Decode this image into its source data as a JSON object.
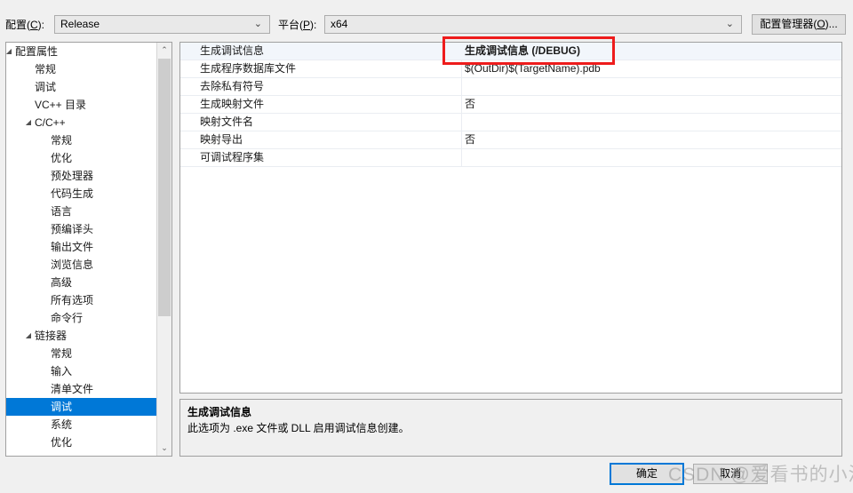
{
  "toolbar": {
    "config_label_prefix": "配置(",
    "config_label_key": "C",
    "config_label_suffix": "):",
    "config_value": "Release",
    "platform_label_prefix": "平台(",
    "platform_label_key": "P",
    "platform_label_suffix": "):",
    "platform_value": "x64",
    "config_manager_prefix": "配置管理器(",
    "config_manager_key": "O",
    "config_manager_suffix": ")...",
    "chevron": "⌄"
  },
  "tree": {
    "items": [
      {
        "label": "配置属性",
        "indent": 10,
        "arrow": "◢",
        "selected": false
      },
      {
        "label": "常规",
        "indent": 32,
        "arrow": "",
        "selected": false
      },
      {
        "label": "调试",
        "indent": 32,
        "arrow": "",
        "selected": false
      },
      {
        "label": "VC++ 目录",
        "indent": 32,
        "arrow": "",
        "selected": false
      },
      {
        "label": "C/C++",
        "indent": 32,
        "arrow": "◢",
        "selected": false
      },
      {
        "label": "常规",
        "indent": 50,
        "arrow": "",
        "selected": false
      },
      {
        "label": "优化",
        "indent": 50,
        "arrow": "",
        "selected": false
      },
      {
        "label": "预处理器",
        "indent": 50,
        "arrow": "",
        "selected": false
      },
      {
        "label": "代码生成",
        "indent": 50,
        "arrow": "",
        "selected": false
      },
      {
        "label": "语言",
        "indent": 50,
        "arrow": "",
        "selected": false
      },
      {
        "label": "预编译头",
        "indent": 50,
        "arrow": "",
        "selected": false
      },
      {
        "label": "输出文件",
        "indent": 50,
        "arrow": "",
        "selected": false
      },
      {
        "label": "浏览信息",
        "indent": 50,
        "arrow": "",
        "selected": false
      },
      {
        "label": "高级",
        "indent": 50,
        "arrow": "",
        "selected": false
      },
      {
        "label": "所有选项",
        "indent": 50,
        "arrow": "",
        "selected": false
      },
      {
        "label": "命令行",
        "indent": 50,
        "arrow": "",
        "selected": false
      },
      {
        "label": "链接器",
        "indent": 32,
        "arrow": "◢",
        "selected": false
      },
      {
        "label": "常规",
        "indent": 50,
        "arrow": "",
        "selected": false
      },
      {
        "label": "输入",
        "indent": 50,
        "arrow": "",
        "selected": false
      },
      {
        "label": "清单文件",
        "indent": 50,
        "arrow": "",
        "selected": false
      },
      {
        "label": "调试",
        "indent": 50,
        "arrow": "",
        "selected": true
      },
      {
        "label": "系统",
        "indent": 50,
        "arrow": "",
        "selected": false
      },
      {
        "label": "优化",
        "indent": 50,
        "arrow": "",
        "selected": false
      }
    ],
    "scroll_up_glyph": "⌃",
    "scroll_down_glyph": "⌄"
  },
  "grid": {
    "rows": [
      {
        "name": "生成调试信息",
        "value": "生成调试信息 (/DEBUG)",
        "bold": true,
        "selected": true
      },
      {
        "name": "生成程序数据库文件",
        "value": "$(OutDir)$(TargetName).pdb",
        "bold": false,
        "selected": false
      },
      {
        "name": "去除私有符号",
        "value": "",
        "bold": false,
        "selected": false
      },
      {
        "name": "生成映射文件",
        "value": "否",
        "bold": false,
        "selected": false
      },
      {
        "name": "映射文件名",
        "value": "",
        "bold": false,
        "selected": false
      },
      {
        "name": "映射导出",
        "value": "否",
        "bold": false,
        "selected": false
      },
      {
        "name": "可调试程序集",
        "value": "",
        "bold": false,
        "selected": false
      }
    ]
  },
  "description": {
    "title": "生成调试信息",
    "body": "此选项为 .exe 文件或 DLL 启用调试信息创建。"
  },
  "footer": {
    "ok_label": "确定",
    "cancel_label": "取消"
  },
  "annotation": {
    "highlight_color": "#ee1c1c"
  },
  "watermark": {
    "text": "CSDN @爱看书的小沐"
  }
}
